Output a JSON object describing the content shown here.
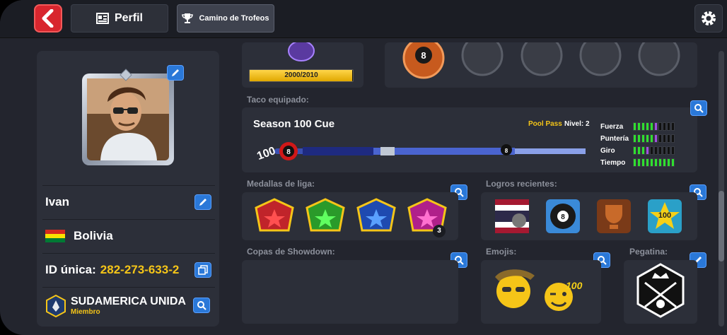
{
  "topbar": {
    "tabs": [
      {
        "label": "Perfil",
        "icon": "profile-card-icon"
      },
      {
        "label": "Camino de Trofeos",
        "icon": "trophy-icon"
      }
    ]
  },
  "profile": {
    "name": "Ivan",
    "country": "Bolivia",
    "unique_id_label": "ID única:",
    "unique_id_value": "282-273-633-2",
    "club_name": "SUDAMERICA UNIDA",
    "club_role": "Miembro"
  },
  "level": {
    "progress_text": "2000/2010",
    "progress_fraction": 0.995
  },
  "cue": {
    "section_label": "Taco equipado:",
    "name": "Season 100 Cue",
    "pass_label": "Pool Pass",
    "level_label": "Nivel: 2",
    "stats": [
      {
        "name": "Fuerza",
        "filled": 5,
        "accent": 1,
        "total": 10
      },
      {
        "name": "Puntería",
        "filled": 5,
        "accent": 1,
        "total": 10
      },
      {
        "name": "Giro",
        "filled": 3,
        "accent": 1,
        "total": 10
      },
      {
        "name": "Tiempo",
        "filled": 10,
        "accent": 0,
        "total": 10
      }
    ]
  },
  "league_medals": {
    "section_label": "Medallas de liga:",
    "medal_badge": "3"
  },
  "achievements": {
    "section_label": "Logros recientes:",
    "badge_text": "100"
  },
  "showdown": {
    "section_label": "Copas de Showdown:"
  },
  "emojis": {
    "section_label": "Emojis:",
    "badge_text": "100"
  },
  "sticker": {
    "section_label": "Pegatina:"
  },
  "colors": {
    "accent_yellow": "#f5c518",
    "button_blue": "#2a78d8",
    "back_red": "#d8262e",
    "stat_green": "#2fe02f",
    "stat_purple": "#a050e0"
  }
}
